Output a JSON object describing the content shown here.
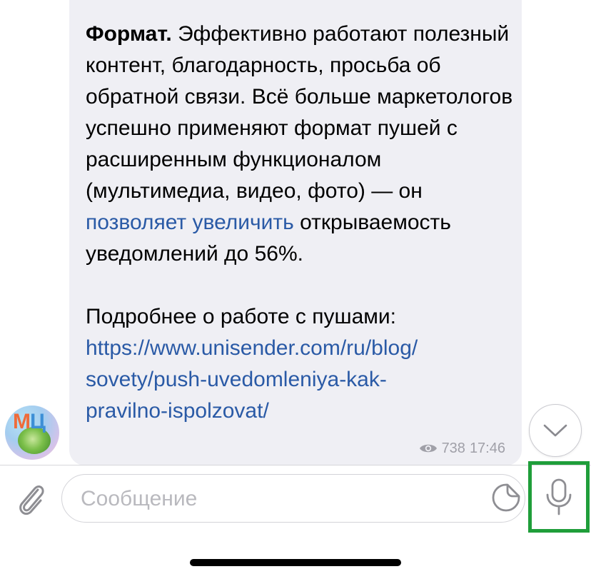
{
  "message": {
    "bold_lead": "Формат.",
    "text_1": " Эффективно работают полезный контент, благодарность, просьба об обратной связи. Всё больше маркетологов успешно применяют формат пушей с расширенным функционалом (мультимедиа, видео, фото) — он ",
    "inline_link": "позволяет увеличить",
    "text_2": " открываемость уведомлений до 56%.",
    "more_label": "Подробнее о работе с пушами:",
    "url_line_1": "https://www.unisender.com/ru/blog/",
    "url_line_2": "sovety/push-uvedomleniya-kak-",
    "url_line_3": "pravilno-ispolzovat/",
    "views": "738",
    "time": "17:46"
  },
  "avatar": {
    "initial_1": "М",
    "initial_2": "Ц"
  },
  "composer": {
    "placeholder": "Сообщение"
  },
  "icons": {
    "views": "eye-icon",
    "scroll": "chevron-down-icon",
    "attach": "paperclip-icon",
    "sticker": "sticker-icon",
    "mic": "microphone-icon"
  },
  "colors": {
    "bubble": "#efeff4",
    "link": "#2a5aa6",
    "highlight": "#1f9e3a"
  }
}
